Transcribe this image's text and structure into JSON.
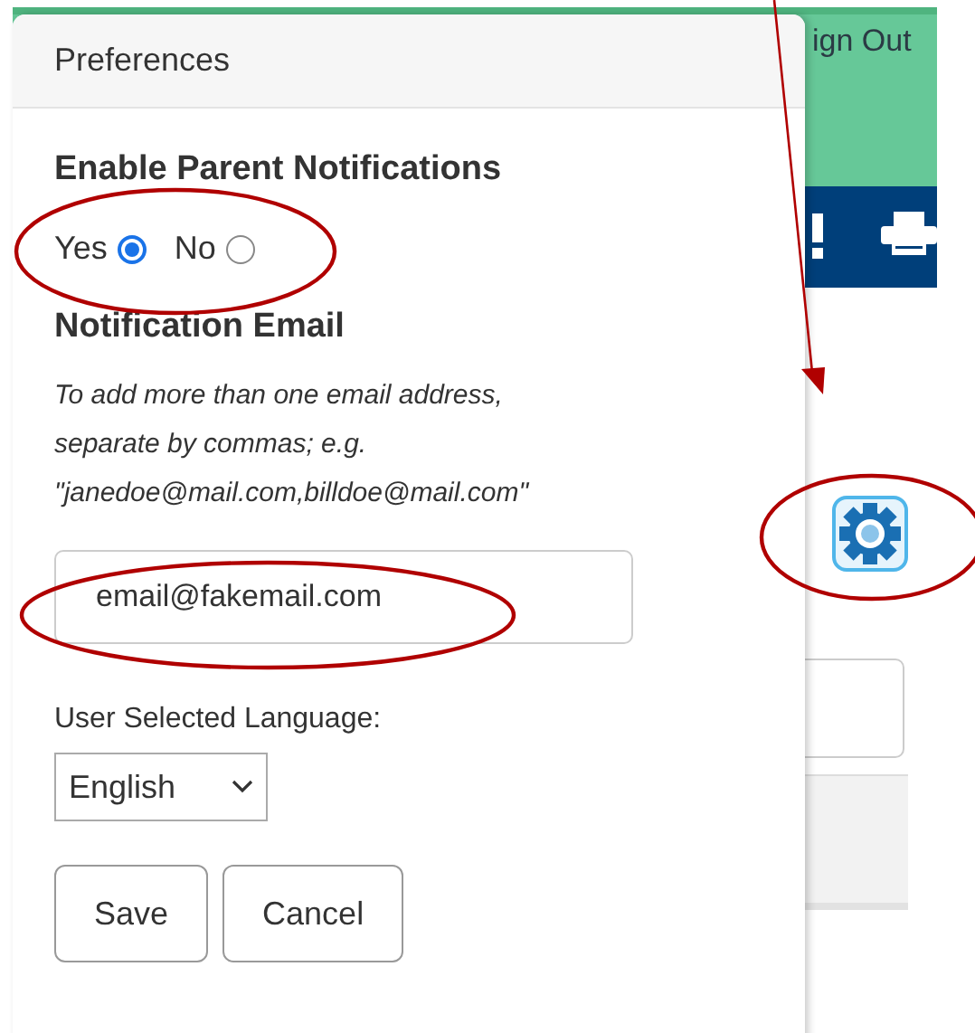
{
  "header": {
    "sign_out": "ign Out"
  },
  "preferences": {
    "title": "Preferences",
    "notifications_heading": "Enable Parent Notifications",
    "options": [
      {
        "label": "Yes",
        "selected": true
      },
      {
        "label": "No",
        "selected": false
      }
    ],
    "email_heading": "Notification Email",
    "email_hint": "To add more than one email address,\nseparate by commas; e.g.\n\"janedoe@mail.com,billdoe@mail.com\"",
    "email": {
      "value": "email@fakemail.com"
    },
    "language_label": "User Selected Language:",
    "language": {
      "value": "English"
    },
    "buttons": [
      "Save",
      "Cancel"
    ]
  }
}
